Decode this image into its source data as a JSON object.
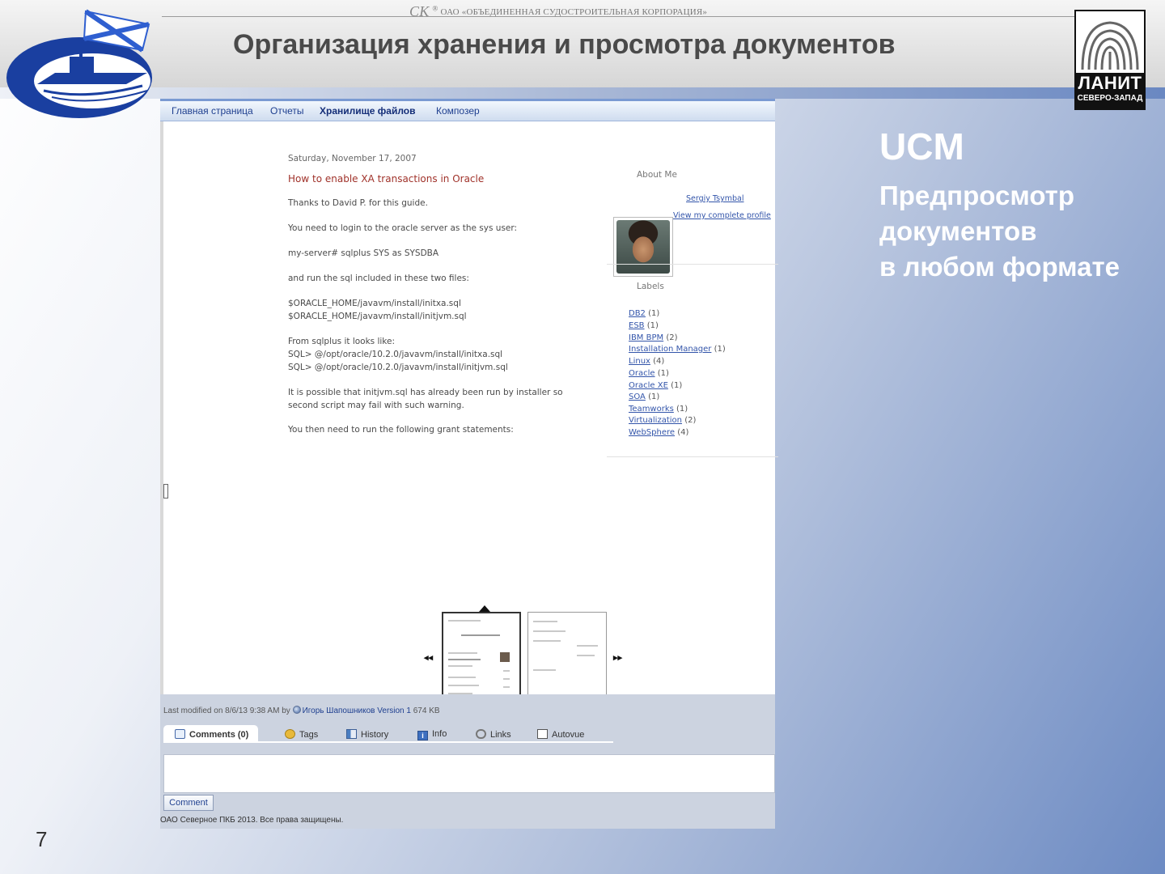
{
  "header": {
    "corp_mark": "СК",
    "corp_tm": "®",
    "corp_name": "ОАО «ОБЪЕДИНЕННАЯ СУДОСТРОИТЕЛЬНАЯ КОРПОРАЦИЯ»",
    "title": "Организация хранения и просмотра документов"
  },
  "lanit_logo": {
    "name": "ЛАНИТ",
    "sub": "СЕВЕРО-ЗАПАД"
  },
  "sidebar": {
    "title": "UCM",
    "subtitle_lines": [
      "Предпросмотр",
      "документов",
      "в любом формате"
    ]
  },
  "page_number": "7",
  "app": {
    "nav": [
      "Главная страница",
      "Отчеты",
      "Хранилище файлов",
      "Композер"
    ],
    "active_nav": "Хранилище файлов",
    "blog": {
      "date": "Saturday, November 17, 2007",
      "post_title": "How to enable XA transactions in Oracle",
      "lines": [
        "Thanks to David P. for this guide.",
        "You need to login to the oracle server as the sys user:",
        "my-server# sqlplus SYS as SYSDBA",
        "and run the sql included in these two files:",
        "$ORACLE_HOME/javavm/install/initxa.sql",
        "$ORACLE_HOME/javavm/install/initjvm.sql",
        "From sqlplus it looks like:",
        "SQL> @/opt/oracle/10.2.0/javavm/install/initxa.sql",
        "SQL> @/opt/oracle/10.2.0/javavm/install/initjvm.sql",
        "It is possible that initjvm.sql has already been run by installer so",
        "second script may fail with such warning.",
        "You then need to run the following grant statements:"
      ],
      "about_heading": "About Me",
      "author": "Sergiy Tsymbal",
      "profile_link": "View my complete profile",
      "labels_heading": "Labels",
      "labels": [
        {
          "name": "DB2",
          "count": "(1)"
        },
        {
          "name": "ESB",
          "count": "(1)"
        },
        {
          "name": "IBM BPM",
          "count": "(2)"
        },
        {
          "name": "Installation Manager",
          "count": "(1)"
        },
        {
          "name": "Linux",
          "count": "(4)"
        },
        {
          "name": "Oracle",
          "count": "(1)"
        },
        {
          "name": "Oracle XE",
          "count": "(1)"
        },
        {
          "name": "SOA",
          "count": "(1)"
        },
        {
          "name": "Teamworks",
          "count": "(1)"
        },
        {
          "name": "Virtualization",
          "count": "(2)"
        },
        {
          "name": "WebSphere",
          "count": "(4)"
        }
      ]
    },
    "pager": {
      "prev": "◂◂",
      "next": "▸▸"
    },
    "meta": {
      "prefix": "Last modified on 8/6/13 9:38 AM by",
      "author": "Игорь Шапошников",
      "version": "Version 1",
      "size": "674 KB"
    },
    "tabs": [
      {
        "label": "Comments (0)",
        "icon": "comment-icon"
      },
      {
        "label": "Tags",
        "icon": "tags-icon"
      },
      {
        "label": "History",
        "icon": "history-icon"
      },
      {
        "label": "Info",
        "icon": "info-icon"
      },
      {
        "label": "Links",
        "icon": "links-icon"
      },
      {
        "label": "Autovue",
        "icon": "autovue-icon"
      }
    ],
    "comment_button": "Comment",
    "copyright": "ОАО Северное ПКБ 2013. Все права защищены."
  }
}
